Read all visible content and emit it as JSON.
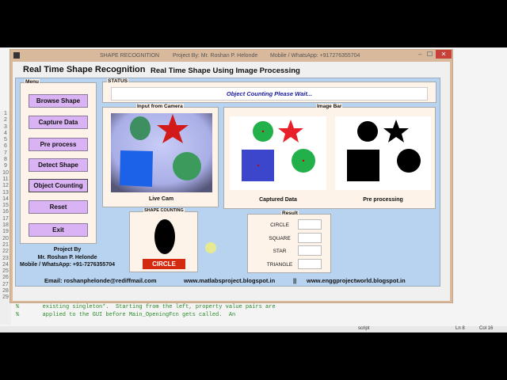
{
  "window": {
    "title": "SHAPE RECOGNITION",
    "project_by": "Project By: Mr. Roshan P. Helonde",
    "mobile": "Mobile / WhatsApp: +917276355704"
  },
  "header": {
    "title": "Real Time Shape Recognition",
    "subtitle": "Real Time Shape Using Image Processing"
  },
  "menu": {
    "label": "Menu",
    "buttons": [
      "Browse Shape",
      "Capture Data",
      "Pre process",
      "Detect Shape",
      "Object Counting",
      "Reset",
      "Exit"
    ]
  },
  "status": {
    "label": "STATUS",
    "text": "Object Counting Please Wait..."
  },
  "camera": {
    "label": "Input from Camera",
    "caption": "Live Cam"
  },
  "image_bar": {
    "label": "Image Bar",
    "captured": "Captured Data",
    "processed": "Pre processing"
  },
  "shape_counting": {
    "label": "SHAPE COUNTING",
    "result": "CIRCLE"
  },
  "result": {
    "label": "Result",
    "rows": [
      "CIRCLE",
      "SQUARE",
      "STAR",
      "TRIANGLE"
    ]
  },
  "credits": {
    "line1": "Project By",
    "line2": "Mr. Roshan P. Helonde",
    "line3": "Mobile / WhatsApp: +91-7276355704"
  },
  "footer": {
    "email": "Email: roshanphelonde@rediffmail.com",
    "site1": "www.matlabsproject.blogspot.in",
    "sep": "||",
    "site2": "www.enggprojectworld.blogspot.in"
  },
  "editor": {
    "code": [
      "%       existing singleton*.  Starting from the left, property value pairs are",
      "%       applied to the GUI before Main_OpeningFcn gets called.  An"
    ],
    "line_numbers": [
      "1",
      "2",
      "3",
      "4",
      "5",
      "6",
      "7",
      "8",
      "9",
      "10",
      "11",
      "12",
      "13",
      "14",
      "15",
      "16",
      "17",
      "18",
      "19",
      "20",
      "21",
      "22",
      "23",
      "24",
      "25",
      "26",
      "27",
      "28",
      "29"
    ],
    "status_mode": "script",
    "ln": "Ln  8",
    "col": "Col  16"
  },
  "colors": {
    "titlebar": "#d9b99b",
    "panel_blue": "#b8d3f0",
    "button": "#d9b3f3",
    "result_red": "#d42a10"
  }
}
